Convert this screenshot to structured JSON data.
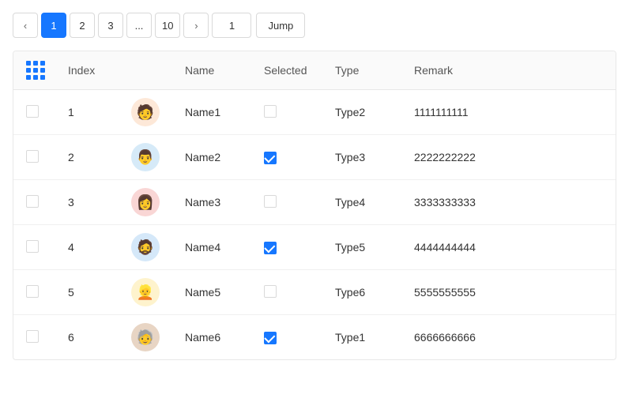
{
  "pagination": {
    "pages": [
      "1",
      "2",
      "3",
      "...",
      "10"
    ],
    "active_page": "1",
    "jump_placeholder": "1",
    "jump_label": "Jump",
    "prev_icon": "‹",
    "next_icon": "›"
  },
  "table": {
    "columns": [
      "",
      "Index",
      "",
      "Name",
      "Selected",
      "Type",
      "Remark"
    ],
    "rows": [
      {
        "index": "1",
        "name": "Name1",
        "selected": false,
        "type": "Type2",
        "remark": "1111111111",
        "avatar": "1",
        "avatar_emoji": "🧑"
      },
      {
        "index": "2",
        "name": "Name2",
        "selected": true,
        "type": "Type3",
        "remark": "2222222222",
        "avatar": "2",
        "avatar_emoji": "👨"
      },
      {
        "index": "3",
        "name": "Name3",
        "selected": false,
        "type": "Type4",
        "remark": "3333333333",
        "avatar": "3",
        "avatar_emoji": "👩"
      },
      {
        "index": "4",
        "name": "Name4",
        "selected": true,
        "type": "Type5",
        "remark": "4444444444",
        "avatar": "4",
        "avatar_emoji": "🧔"
      },
      {
        "index": "5",
        "name": "Name5",
        "selected": false,
        "type": "Type6",
        "remark": "5555555555",
        "avatar": "5",
        "avatar_emoji": "👱"
      },
      {
        "index": "6",
        "name": "Name6",
        "selected": true,
        "type": "Type1",
        "remark": "6666666666",
        "avatar": "6",
        "avatar_emoji": "🧓"
      }
    ],
    "col_index_label": "Index",
    "col_name_label": "Name",
    "col_selected_label": "Selected",
    "col_type_label": "Type",
    "col_remark_label": "Remark"
  }
}
